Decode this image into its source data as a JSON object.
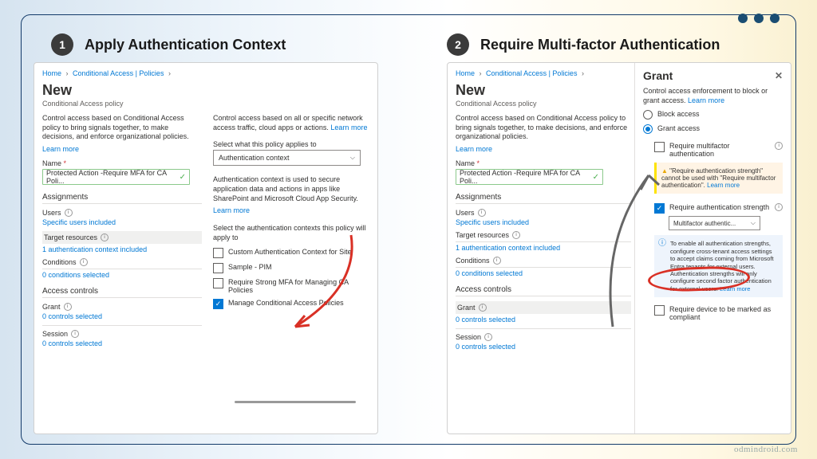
{
  "steps": {
    "one": {
      "num": "1",
      "title": "Apply Authentication Context"
    },
    "two": {
      "num": "2",
      "title": "Require Multi-factor Authentication"
    }
  },
  "breadcrumb": {
    "home": "Home",
    "ca": "Conditional Access | Policies"
  },
  "heading": "New",
  "subheading": "Conditional Access policy",
  "panel1": {
    "desc_left": "Control access based on Conditional Access policy to bring signals together, to make decisions, and enforce organizational policies.",
    "learn": "Learn more",
    "name_label": "Name",
    "name_value": "Protected Action -Require MFA for CA Poli...",
    "assignments": "Assignments",
    "users": "Users",
    "users_val": "Specific users included",
    "target": "Target resources",
    "target_val": "1 authentication context included",
    "conditions": "Conditions",
    "conditions_val": "0 conditions selected",
    "controls": "Access controls",
    "grant": "Grant",
    "grant_val": "0 controls selected",
    "session": "Session",
    "session_val": "0 controls selected",
    "desc_right": "Control access based on all or specific network access traffic, cloud apps or actions.",
    "select_applies": "Select what this policy applies to",
    "applies_value": "Authentication context",
    "auth_ctx_desc": "Authentication context is used to secure application data and actions in apps like SharePoint and Microsoft Cloud App Security.",
    "select_ctx": "Select the authentication contexts this policy will apply to",
    "opts": [
      "Custom Authentication Context for Site",
      "Sample - PIM",
      "Require Strong MFA for Managing CA Policies",
      "Manage Conditional Access Policies"
    ]
  },
  "panel2": {
    "target_val": "1 authentication context included",
    "grant_title": "Grant",
    "grant_desc": "Control access enforcement to block or grant access.",
    "block": "Block access",
    "grant_access": "Grant access",
    "req_mfa": "Require multifactor authentication",
    "warn": "\"Require authentication strength\" cannot be used with \"Require multifactor authentication\".",
    "req_strength": "Require authentication strength",
    "strength_val": "Multifactor authentic...",
    "info": "To enable all authentication strengths, configure cross-tenant access settings to accept claims coming from Microsoft Entra tenants for external users. Authentication strengths will only configure second factor authentication for external users.",
    "req_compliant": "Require device to be marked as compliant"
  },
  "watermark": "odmindroid.com"
}
